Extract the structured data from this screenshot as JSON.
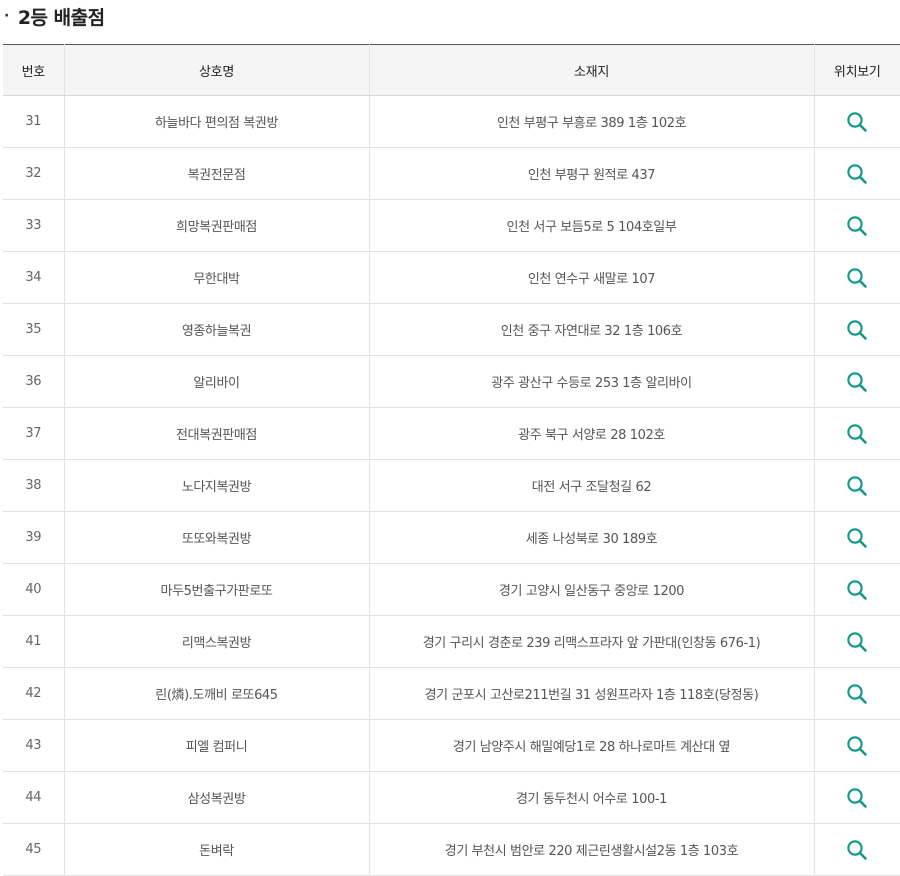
{
  "section": {
    "bullet": "·",
    "title": "2등 배출점"
  },
  "table": {
    "headers": {
      "no": "번호",
      "name": "상호명",
      "address": "소재지",
      "map": "위치보기"
    },
    "rows": [
      {
        "no": "31",
        "name": "하늘바다 편의점 복권방",
        "address": "인천 부평구 부흥로 389 1층 102호"
      },
      {
        "no": "32",
        "name": "복권전문점",
        "address": "인천 부평구 원적로 437"
      },
      {
        "no": "33",
        "name": "희망복권판매점",
        "address": "인천 서구 보듬5로 5 104호일부"
      },
      {
        "no": "34",
        "name": "무한대박",
        "address": "인천 연수구 새말로 107"
      },
      {
        "no": "35",
        "name": "영종하늘복권",
        "address": "인천 중구 자연대로 32 1층 106호"
      },
      {
        "no": "36",
        "name": "알리바이",
        "address": "광주 광산구 수등로 253 1층 알리바이"
      },
      {
        "no": "37",
        "name": "전대복권판매점",
        "address": "광주 북구 서양로 28 102호"
      },
      {
        "no": "38",
        "name": "노다지복권방",
        "address": "대전 서구 조달청길 62"
      },
      {
        "no": "39",
        "name": "또또와복권방",
        "address": "세종 나성북로 30 189호"
      },
      {
        "no": "40",
        "name": "마두5번출구가판로또",
        "address": "경기 고양시 일산동구 중앙로 1200"
      },
      {
        "no": "41",
        "name": "리맥스복권방",
        "address": "경기 구리시 경춘로 239 리맥스프라자 앞 가판대(인창동 676-1)"
      },
      {
        "no": "42",
        "name": "린(燐).도깨비 로또645",
        "address": "경기 군포시 고산로211번길 31 성원프라자 1층 118호(당정동)"
      },
      {
        "no": "43",
        "name": "피엘 컴퍼니",
        "address": "경기 남양주시 해밀예당1로 28 하나로마트 계산대 옆"
      },
      {
        "no": "44",
        "name": "삼성복권방",
        "address": "경기 동두천시 어수로 100-1"
      },
      {
        "no": "45",
        "name": "돈벼락",
        "address": "경기 부천시 범안로 220 제근린생활시설2동 1층 103호"
      }
    ]
  },
  "icons": {
    "map_search": "search-icon"
  },
  "colors": {
    "icon": "#159a8c",
    "header_bg": "#f5f5f5",
    "title": "#222222",
    "cell_text": "#555555"
  }
}
